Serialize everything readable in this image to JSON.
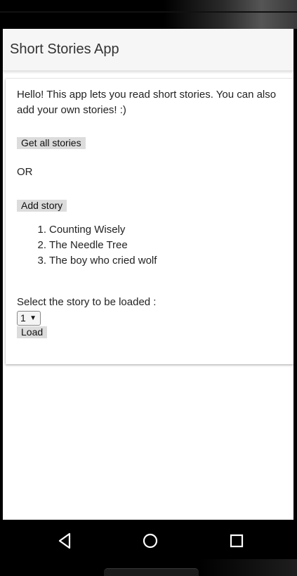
{
  "app": {
    "title": "Short Stories App"
  },
  "content": {
    "intro": "Hello! This app lets you read short stories. You can also add your own stories! :)",
    "get_all_label": "Get all stories",
    "or_label": "OR",
    "add_story_label": "Add story",
    "stories": [
      {
        "num": "1.",
        "title": "Counting Wisely"
      },
      {
        "num": "2.",
        "title": "The Needle Tree"
      },
      {
        "num": "3.",
        "title": "The boy who cried wolf"
      }
    ],
    "select_label": "Select the story to be loaded :",
    "selected_value": "1",
    "load_label": "Load"
  },
  "navbar": {
    "icons": [
      "back-icon",
      "home-icon",
      "recents-icon"
    ]
  }
}
